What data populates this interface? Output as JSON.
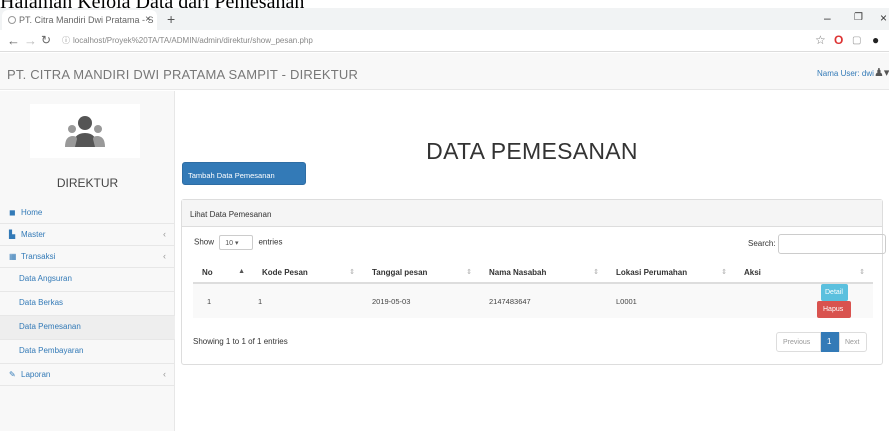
{
  "caption": "Halaman Kelola Data dari Pemesanan",
  "browser": {
    "tab_title": "PT. Citra Mandiri Dwi Pratama - S",
    "tab_close": "×",
    "new_tab": "+",
    "url": "localhost/Proyek%20TA/TA/ADMIN/admin/direktur/show_pesan.php",
    "minimize": "–",
    "maximize": "❐",
    "close": "×"
  },
  "header": {
    "brand": "PT. CITRA MANDIRI DWI PRATAMA SAMPIT - DIREKTUR",
    "user_label": "Nama User: dwi"
  },
  "sidebar": {
    "role": "DIREKTUR",
    "items": [
      {
        "label": "Home",
        "icon": "dashboard-icon"
      },
      {
        "label": "Master",
        "icon": "bar-chart-icon"
      },
      {
        "label": "Transaksi",
        "icon": "table-icon"
      },
      {
        "label": "Data Angsuran"
      },
      {
        "label": "Data Berkas"
      },
      {
        "label": "Data Pemesanan"
      },
      {
        "label": "Data Pembayaran"
      },
      {
        "label": "Laporan",
        "icon": "edit-icon"
      }
    ]
  },
  "main": {
    "title": "DATA PEMESANAN",
    "add_button": "Tambah Data Pemesanan",
    "panel_heading": "Lihat Data Pemesanan",
    "show_label": "Show",
    "entries_value": "10",
    "entries_label": "entries",
    "search_label": "Search:",
    "columns": [
      "No",
      "Kode Pesan",
      "Tanggal pesan",
      "Nama Nasabah",
      "Lokasi Perumahan",
      "Aksi"
    ],
    "rows": [
      {
        "no": "1",
        "kode": "1",
        "tanggal": "2019-05-03",
        "nama": "2147483647",
        "lokasi": "L0001",
        "detail": "Detail",
        "hapus": "Hapus"
      }
    ],
    "info": "Showing 1 to 1 of 1 entries",
    "pager": {
      "prev": "Previous",
      "page": "1",
      "next": "Next"
    }
  },
  "colors": {
    "primary": "#337ab7",
    "info": "#5bc0de",
    "danger": "#d9534f"
  }
}
